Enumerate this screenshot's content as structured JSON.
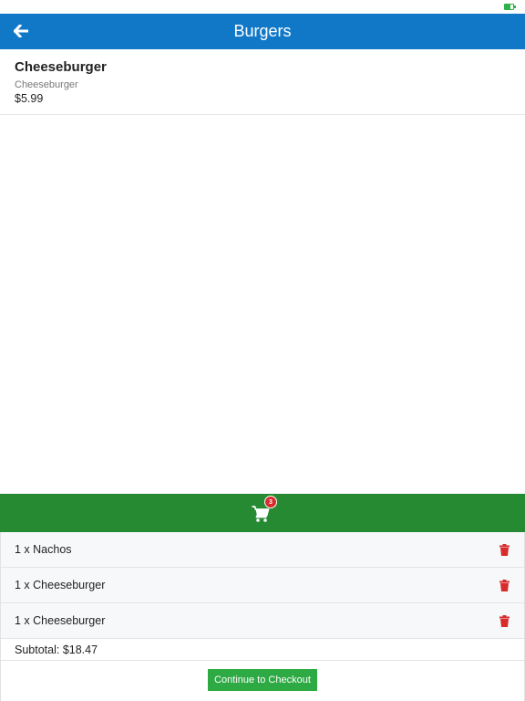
{
  "header": {
    "title": "Burgers",
    "back_icon": "arrow-left-icon"
  },
  "product": {
    "name": "Cheeseburger",
    "description": "Cheeseburger",
    "price": "$5.99"
  },
  "cart": {
    "icon": "cart-icon",
    "count": "3",
    "items": [
      {
        "label": "1 x Nachos"
      },
      {
        "label": "1 x Cheeseburger"
      },
      {
        "label": "1 x Cheeseburger"
      }
    ],
    "subtotal": "Subtotal: $18.47",
    "checkout_label": "Continue to Checkout"
  },
  "colors": {
    "header_bg": "#1178c8",
    "cart_bar_bg": "#258a32",
    "checkout_bg": "#2eaa44",
    "trash": "#d62c2c",
    "badge": "#d62c2c",
    "battery": "#2fb24a"
  }
}
